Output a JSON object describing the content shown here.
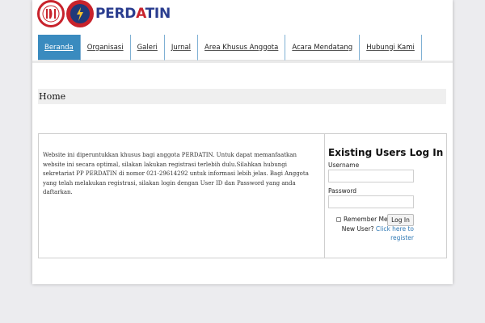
{
  "site": {
    "logo_text_main": "PERD",
    "logo_text_accent": "A",
    "logo_text_end": "TIN"
  },
  "nav": {
    "items": [
      {
        "label": "Beranda",
        "active": true
      },
      {
        "label": "Organisasi"
      },
      {
        "label": "Galeri"
      },
      {
        "label": "Jurnal"
      },
      {
        "label": "Area Khusus Anggota"
      },
      {
        "label": "Acara Mendatang"
      },
      {
        "label": "Hubungi Kami"
      }
    ]
  },
  "breadcrumb": {
    "title": "Home"
  },
  "main": {
    "notice": "Website ini diperuntukkan khusus bagi anggota PERDATIN. Untuk dapat memanfaatkan website ini secara optimal, silakan lakukan registrasi terlebih dulu.Silahkan hubungi sekretariat PP PERDATIN di nomor 021-29614292 untuk informasi lebih jelas. Bagi Anggota yang telah melakukan registrasi, silakan login dengan User ID dan Password yang anda daftarkan."
  },
  "login": {
    "title": "Existing Users Log In",
    "username_label": "Username",
    "username_value": "",
    "password_label": "Password",
    "password_value": "",
    "remember_label": "Remember Me",
    "login_button": "Log In",
    "new_user_text": "New User?",
    "register_link": "Click here to register"
  },
  "colors": {
    "nav_active": "#3a8bbf",
    "link": "#2f79b5",
    "brand_red": "#c8232c",
    "brand_blue": "#2a3d8f"
  }
}
